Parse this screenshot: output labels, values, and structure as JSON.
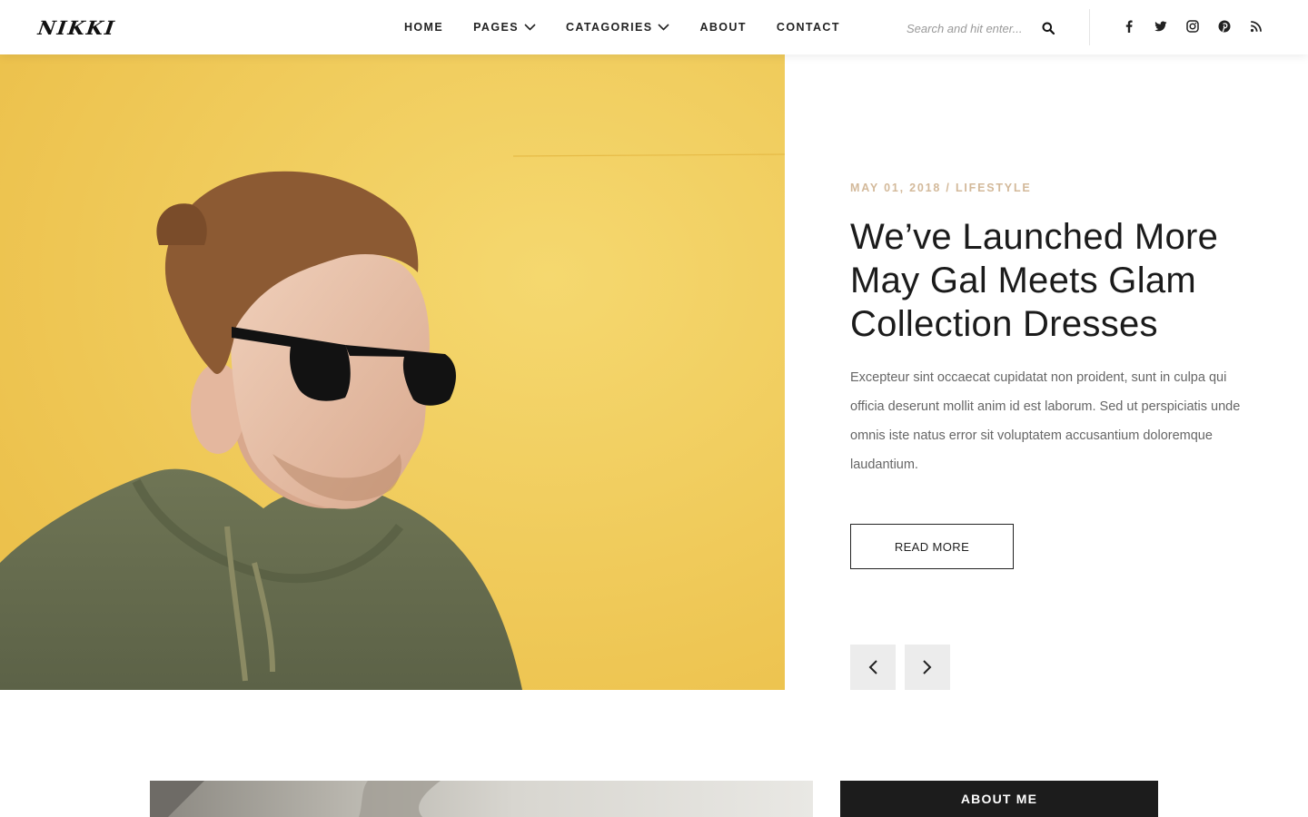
{
  "header": {
    "logo": "NIKKI",
    "nav": [
      {
        "label": "HOME",
        "has_dropdown": false
      },
      {
        "label": "PAGES",
        "has_dropdown": true
      },
      {
        "label": "CATAGORIES",
        "has_dropdown": true
      },
      {
        "label": "ABOUT",
        "has_dropdown": false
      },
      {
        "label": "CONTACT",
        "has_dropdown": false
      }
    ],
    "search": {
      "placeholder": "Search and hit enter...",
      "icon": "search-icon"
    },
    "social": [
      "facebook-icon",
      "twitter-icon",
      "instagram-icon",
      "pinterest-icon",
      "rss-icon"
    ]
  },
  "hero": {
    "image": "man-with-sunglasses-yellow-wall",
    "meta": "MAY 01, 2018 / LIFESTYLE",
    "title": "We’ve Launched More May Gal Meets Glam Collection Dresses",
    "excerpt": "Excepteur sint occaecat cupidatat non proident, sunt in culpa qui officia deserunt mollit anim id est laborum. Sed ut perspiciatis unde omnis iste natus error sit voluptatem accusantium doloremque laudantium.",
    "read_more": "READ MORE",
    "prev_icon": "chevron-left-icon",
    "next_icon": "chevron-right-icon"
  },
  "sidebar": {
    "about_title": "ABOUT ME"
  },
  "colors": {
    "accent_meta": "#d3b99a",
    "hero_bg": "#f2cd5c",
    "dark": "#1c1c1c"
  }
}
